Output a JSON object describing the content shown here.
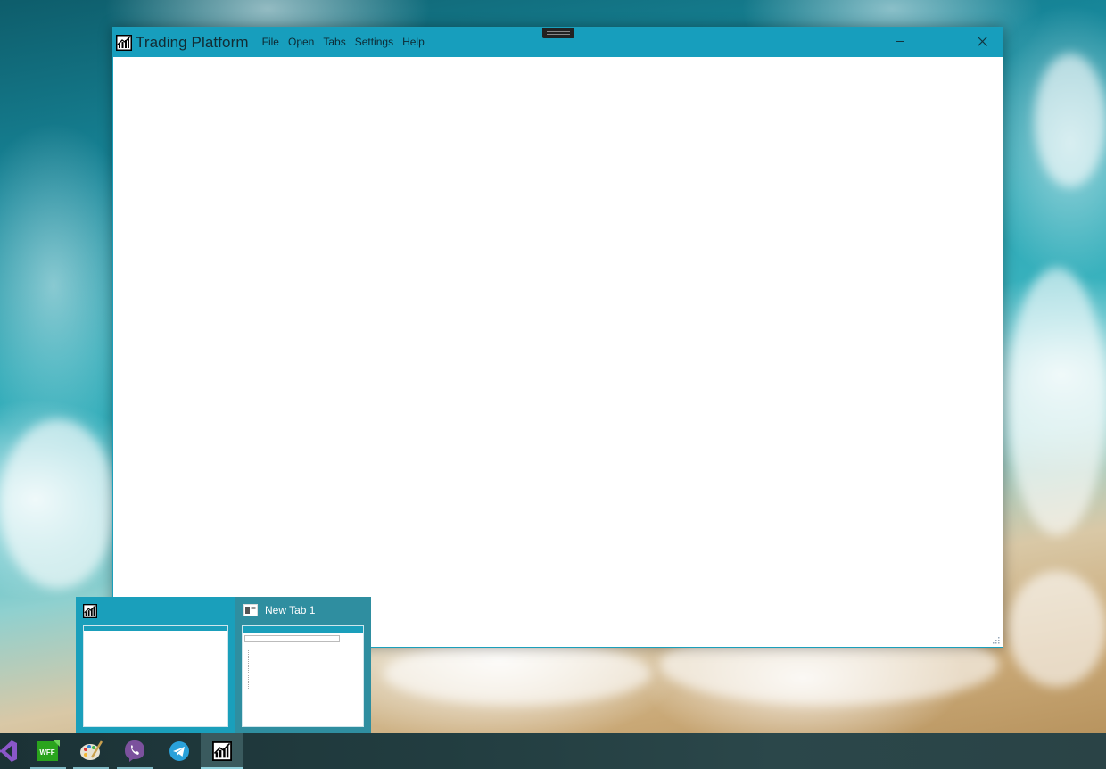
{
  "window": {
    "title": "Trading Platform",
    "menu": [
      "File",
      "Open",
      "Tabs",
      "Settings",
      "Help"
    ],
    "controls": {
      "minimize": "—",
      "maximize": "□",
      "close": "✕"
    }
  },
  "thumbnails": [
    {
      "label": "",
      "icon": "trading-chart-icon"
    },
    {
      "label": "New Tab 1",
      "icon": "tab-window-icon"
    }
  ],
  "taskbar": {
    "items": [
      {
        "name": "visual-studio-icon",
        "color": "#8a57c9"
      },
      {
        "name": "wff-app-icon",
        "label": "WFF",
        "color": "#2aa41d"
      },
      {
        "name": "paint-palette-icon",
        "color": "#c9a04e"
      },
      {
        "name": "viber-icon",
        "color": "#7b519d"
      },
      {
        "name": "telegram-icon",
        "color": "#2aa1da"
      },
      {
        "name": "trading-platform-icon",
        "color": "#000000",
        "active": true
      }
    ]
  },
  "colors": {
    "titlebar": "#179ebd",
    "taskbar": "#223d40",
    "accent": "#8ed0dc"
  }
}
